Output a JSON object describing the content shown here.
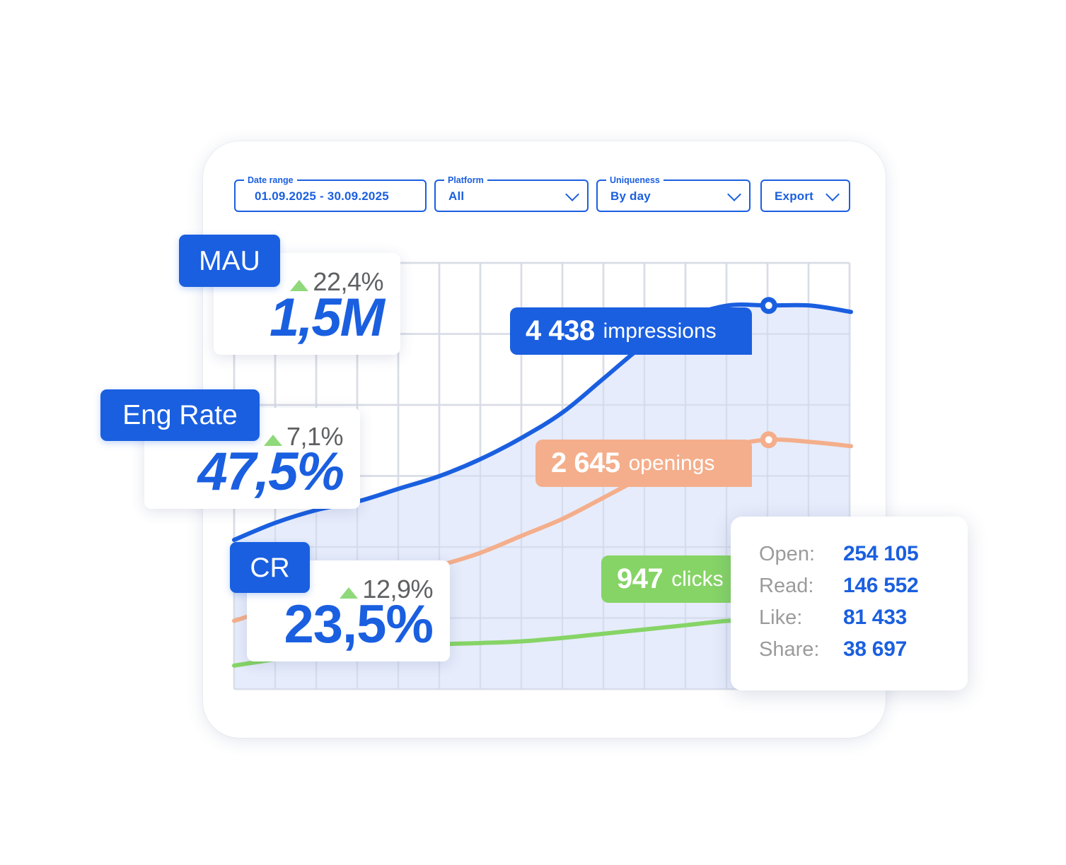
{
  "filters": {
    "date_range": {
      "label": "Date range",
      "value": "01.09.2025 - 30.09.2025"
    },
    "platform": {
      "label": "Platform",
      "value": "All",
      "icon": "chevron-down-icon"
    },
    "uniqueness": {
      "label": "Uniqueness",
      "value": "By day",
      "icon": "chevron-down-icon"
    },
    "export": {
      "label": "Export",
      "icon": "chevron-down-icon"
    }
  },
  "kpis": [
    {
      "name": "MAU",
      "delta": "22,4%",
      "value": "1,5M",
      "trend": "up"
    },
    {
      "name": "Eng Rate",
      "delta": "7,1%",
      "value": "47,5%",
      "trend": "up"
    },
    {
      "name": "CR",
      "delta": "12,9%",
      "value": "23,5%",
      "trend": "up"
    }
  ],
  "series_labels": [
    {
      "value": "4 438",
      "unit": "impressions",
      "color": "#1a5fe0"
    },
    {
      "value": "2 645",
      "unit": "openings",
      "color": "#f4ae8b"
    },
    {
      "value": "947",
      "unit": "clicks",
      "color": "#86d466"
    }
  ],
  "tooltip": {
    "rows": [
      {
        "label": "Open:",
        "value": "254 105"
      },
      {
        "label": "Read:",
        "value": "146 552"
      },
      {
        "label": "Like:",
        "value": "81 433"
      },
      {
        "label": "Share:",
        "value": "38 697"
      }
    ]
  },
  "colors": {
    "accent": "#1a5fe0",
    "impressions": "#1a5fe0",
    "openings": "#f4ae8b",
    "clicks": "#86d466",
    "trend_up": "#8fd97a",
    "area_fill": "#e6edfb"
  },
  "chart_data": {
    "type": "line",
    "title": "",
    "xlabel": "",
    "ylabel": "",
    "grid": true,
    "x": [
      0,
      1,
      2,
      3,
      4,
      5,
      6,
      7,
      8,
      9,
      10,
      11,
      12,
      13,
      14,
      15
    ],
    "ylim": [
      0,
      100
    ],
    "series": [
      {
        "name": "impressions",
        "color": "#1a5fe0",
        "filled": true,
        "values": [
          35,
          39,
          42,
          44,
          47,
          50,
          54,
          59,
          65,
          73,
          81,
          87,
          90,
          90,
          90,
          88.5
        ],
        "highlight_index": 13
      },
      {
        "name": "openings",
        "color": "#f4ae8b",
        "filled": false,
        "values": [
          16,
          19,
          21.5,
          24,
          26.5,
          29,
          32,
          36,
          40,
          45,
          50,
          54,
          57,
          58.5,
          58,
          57
        ],
        "highlight_index": 13
      },
      {
        "name": "clicks",
        "color": "#86d466",
        "filled": false,
        "values": [
          5.5,
          7,
          8.5,
          9.5,
          10,
          10.5,
          10.8,
          11.2,
          12,
          13,
          14,
          15,
          16,
          16.3
        ],
        "highlight_index": null
      }
    ]
  }
}
